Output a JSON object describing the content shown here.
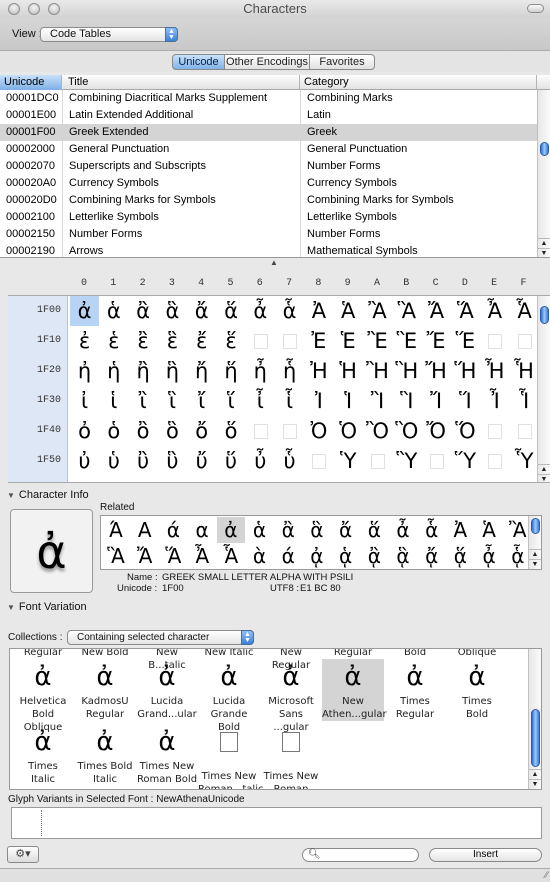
{
  "window": {
    "title": "Characters"
  },
  "toolbar": {
    "view_label": "View :",
    "view_value": "Code Tables"
  },
  "tabs": [
    {
      "label": "Unicode",
      "selected": true
    },
    {
      "label": "Other Encodings",
      "selected": false
    },
    {
      "label": "Favorites",
      "selected": false
    }
  ],
  "blocks_table": {
    "headers": [
      "Unicode",
      "Title",
      "Category"
    ],
    "rows": [
      {
        "code": "00001DC0",
        "title": "Combining Diacritical Marks Supplement",
        "category": "Combining Marks"
      },
      {
        "code": "00001E00",
        "title": "Latin Extended Additional",
        "category": "Latin"
      },
      {
        "code": "00001F00",
        "title": "Greek Extended",
        "category": "Greek",
        "selected": true
      },
      {
        "code": "00002000",
        "title": "General Punctuation",
        "category": "General Punctuation"
      },
      {
        "code": "00002070",
        "title": "Superscripts and Subscripts",
        "category": "Number Forms"
      },
      {
        "code": "000020A0",
        "title": "Currency Symbols",
        "category": "Currency Symbols"
      },
      {
        "code": "000020D0",
        "title": "Combining Marks for Symbols",
        "category": "Combining Marks for Symbols"
      },
      {
        "code": "00002100",
        "title": "Letterlike Symbols",
        "category": "Letterlike Symbols"
      },
      {
        "code": "00002150",
        "title": "Number Forms",
        "category": "Number Forms"
      },
      {
        "code": "00002190",
        "title": "Arrows",
        "category": "Mathematical Symbols"
      }
    ]
  },
  "char_grid": {
    "columns": [
      "0",
      "1",
      "2",
      "3",
      "4",
      "5",
      "6",
      "7",
      "8",
      "9",
      "A",
      "B",
      "C",
      "D",
      "E",
      "F"
    ],
    "rows": [
      {
        "label": "1F00",
        "chars": [
          "ἀ",
          "ἁ",
          "ἂ",
          "ἃ",
          "ἄ",
          "ἅ",
          "ἆ",
          "ἇ",
          "Ἀ",
          "Ἁ",
          "Ἂ",
          "Ἃ",
          "Ἄ",
          "Ἅ",
          "Ἆ",
          "Ἇ"
        ]
      },
      {
        "label": "1F10",
        "chars": [
          "ἐ",
          "ἑ",
          "ἒ",
          "ἓ",
          "ἔ",
          "ἕ",
          "",
          "",
          "Ἐ",
          "Ἑ",
          "Ἒ",
          "Ἓ",
          "Ἔ",
          "Ἕ",
          "",
          ""
        ]
      },
      {
        "label": "1F20",
        "chars": [
          "ἠ",
          "ἡ",
          "ἢ",
          "ἣ",
          "ἤ",
          "ἥ",
          "ἦ",
          "ἧ",
          "Ἠ",
          "Ἡ",
          "Ἢ",
          "Ἣ",
          "Ἤ",
          "Ἥ",
          "Ἦ",
          "Ἧ"
        ]
      },
      {
        "label": "1F30",
        "chars": [
          "ἰ",
          "ἱ",
          "ἲ",
          "ἳ",
          "ἴ",
          "ἵ",
          "ἶ",
          "ἷ",
          "Ἰ",
          "Ἱ",
          "Ἲ",
          "Ἳ",
          "Ἴ",
          "Ἵ",
          "Ἶ",
          "Ἷ"
        ]
      },
      {
        "label": "1F40",
        "chars": [
          "ὀ",
          "ὁ",
          "ὂ",
          "ὃ",
          "ὄ",
          "ὅ",
          "",
          "",
          "Ὀ",
          "Ὁ",
          "Ὂ",
          "Ὃ",
          "Ὄ",
          "Ὅ",
          "",
          ""
        ]
      },
      {
        "label": "1F50",
        "chars": [
          "ὐ",
          "ὑ",
          "ὒ",
          "ὓ",
          "ὔ",
          "ὕ",
          "ὖ",
          "ὗ",
          "",
          "Ὑ",
          "",
          "Ὓ",
          "",
          "Ὕ",
          "",
          "Ὗ"
        ]
      }
    ],
    "selected": "1F00-0"
  },
  "character_info": {
    "section_label": "Character Info",
    "selected_char": "ἀ",
    "related_label": "Related",
    "related_row1": [
      "Ά",
      "Α",
      "ά",
      "α",
      "ἀ",
      "ἁ",
      "ἂ",
      "ἃ",
      "ἄ",
      "ἅ",
      "ἆ",
      "ἇ",
      "Ἀ",
      "Ἁ",
      "Ἂ"
    ],
    "related_row2": [
      "Ἃ",
      "Ἄ",
      "Ἅ",
      "Ἆ",
      "Ἇ",
      "ὰ",
      "ά",
      "ᾀ",
      "ᾁ",
      "ᾂ",
      "ᾃ",
      "ᾄ",
      "ᾅ",
      "ᾆ",
      "ᾇ"
    ],
    "name_label": "Name :",
    "name_value": "GREEK SMALL LETTER ALPHA WITH PSILI",
    "unicode_label": "Unicode :",
    "unicode_value": "1F00",
    "utf8_label": "UTF8 :",
    "utf8_value": "E1 BC 80"
  },
  "font_variation": {
    "section_label": "Font Variation",
    "collections_label": "Collections :",
    "collections_value": "Containing selected character",
    "top_partial_labels": [
      "Regular",
      "New Bold",
      "New B...talic",
      "New Italic",
      "New Regular",
      "Regular",
      "Bold",
      "Oblique"
    ],
    "fonts_row1": [
      {
        "line1": "Helvetica",
        "line2": "Bold Oblique",
        "glyph": "ἀ"
      },
      {
        "line1": "KadmosU",
        "line2": "Regular",
        "glyph": "ἀ"
      },
      {
        "line1": "Lucida",
        "line2": "Grand...ular",
        "glyph": "ἀ"
      },
      {
        "line1": "Lucida",
        "line2": "Grande Bold",
        "glyph": "ἀ"
      },
      {
        "line1": "Microsoft",
        "line2": "Sans ...gular",
        "glyph": "ἀ"
      },
      {
        "line1": "New",
        "line2": "Athen...gular",
        "glyph": "ἀ",
        "selected": true
      },
      {
        "line1": "Times",
        "line2": "Regular",
        "glyph": "ἀ"
      },
      {
        "line1": "Times",
        "line2": "Bold",
        "glyph": "ἀ"
      }
    ],
    "fonts_row2": [
      {
        "line1": "Times",
        "line2": "Italic",
        "glyph": "ἀ"
      },
      {
        "line1": "Times Bold",
        "line2": "Italic",
        "glyph": "ἀ"
      },
      {
        "line1": "Times New",
        "line2": "Roman Bold",
        "glyph": "ἀ"
      },
      {
        "line1": "Times New",
        "line2": "Roman...talic",
        "glyph": ""
      },
      {
        "line1": "Times New",
        "line2": "Roman Italic",
        "glyph": ""
      }
    ],
    "glyph_variants_label": "Glyph Variants in Selected Font : NewAthenaUnicode"
  },
  "footer": {
    "gear_icon": "gear-icon",
    "search_placeholder": "",
    "insert_label": "Insert"
  }
}
